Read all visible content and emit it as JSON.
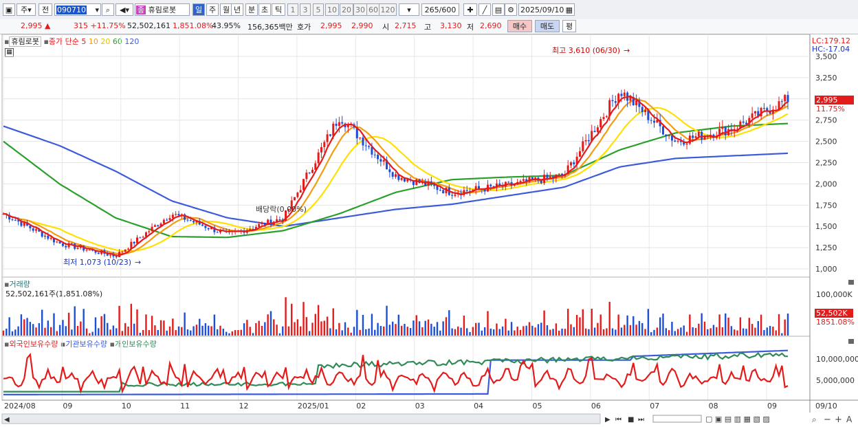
{
  "toolbar": {
    "period_type": "주",
    "prev_label": "전",
    "code": "090710",
    "stock_name": "휴림로봇",
    "stock_tag": "종",
    "tabs": [
      "일",
      "주",
      "월",
      "년",
      "분",
      "초",
      "틱"
    ],
    "numbers": [
      "1",
      "3",
      "5",
      "10",
      "20",
      "30",
      "60",
      "120"
    ],
    "count": "265",
    "count_max": "/600",
    "date": "2025/09/10"
  },
  "info": {
    "price": "2,995",
    "change": "315 +11.75%",
    "volume": "52,502,161",
    "volume_pct": "1,851.08%",
    "turnover": "43.95%",
    "amount": "156,365백만",
    "bid_label": "호가",
    "bid1": "2,995",
    "bid2": "2,990",
    "open_label": "시",
    "open": "2,715",
    "high_label": "고",
    "high": "3,130",
    "low_label": "저",
    "low": "2,690",
    "buy_label": "매수",
    "sell_label": "매도",
    "eval_label": "평"
  },
  "colors": {
    "ma5": "#e41b1b",
    "ma10": "#f39c12",
    "ma20": "#ffe000",
    "ma60": "#2aa02a",
    "ma120": "#3b5bdb",
    "up": "#e41b1b",
    "down": "#1d4fd6",
    "foreign": "#e41b1b",
    "inst": "#3b5bdb",
    "indiv": "#2e8b57"
  },
  "price_panel": {
    "legend_name": "휴림로봇",
    "legend_series": "종가 단순",
    "ma_periods": [
      "5",
      "10",
      "20",
      "60",
      "120"
    ],
    "lc": "LC:179.12",
    "hc": "HC:-17.04",
    "last_price": "2,995",
    "last_pct": "11.75%",
    "high_note": "최고 3,610 (06/30)",
    "low_note": "최저 1,073 (10/23)",
    "dividend_note": "배당락(0.00%)",
    "yticks": [
      "3,500",
      "3,250",
      "3,000",
      "2,750",
      "2,500",
      "2,250",
      "2,000",
      "1,750",
      "1,500",
      "1,250",
      "1,000"
    ]
  },
  "volume_panel": {
    "title": "거래량",
    "value": "52,502,161주(1,851.08%)",
    "ytick": "100,000K",
    "last": "52,502K",
    "last_pct": "1851.08%"
  },
  "holding_panel": {
    "legend": [
      "외국인보유수량",
      "기관보유수량",
      "개인보유수량"
    ],
    "yticks": [
      "10,000,000",
      "5,000,000"
    ]
  },
  "xaxis": {
    "labels": [
      "2024/08",
      "09",
      "10",
      "11",
      "12",
      "2025/01",
      "02",
      "03",
      "04",
      "05",
      "06",
      "07",
      "08",
      "09"
    ],
    "end_label": "09/10"
  },
  "chart_data": {
    "type": "candlestick",
    "ylim": [
      1000,
      3600
    ],
    "x": [
      "2024/08",
      "09",
      "10",
      "11",
      "12",
      "2025/01",
      "02",
      "03",
      "04",
      "05",
      "06",
      "07",
      "08",
      "09",
      "09/10"
    ],
    "close_approx": [
      1650,
      1300,
      1150,
      1650,
      1400,
      1600,
      2800,
      2100,
      1900,
      1980,
      2100,
      3100,
      2500,
      2650,
      2995
    ],
    "ma120_approx": [
      2680,
      2450,
      2150,
      1800,
      1600,
      1500,
      1600,
      1700,
      1760,
      1860,
      1960,
      2200,
      2300,
      2330,
      2360
    ],
    "ma60_approx": [
      2500,
      2000,
      1600,
      1380,
      1370,
      1450,
      1650,
      1900,
      2050,
      2080,
      2100,
      2400,
      2600,
      2680,
      2710
    ],
    "annotations": [
      "최고 3,610 (06/30)",
      "최저 1,073 (10/23)",
      "배당락(0.00%)"
    ]
  }
}
